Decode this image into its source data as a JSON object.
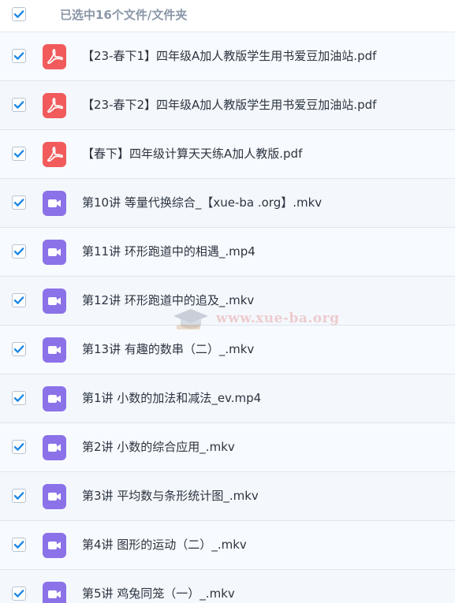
{
  "header": {
    "title": "已选中16个文件/文件夹",
    "select_all_checked": true
  },
  "files": [
    {
      "name": "【23-春下1】四年级A加人教版学生用书爱豆加油站.pdf",
      "type": "pdf",
      "icon": "pdf-icon",
      "checked": true
    },
    {
      "name": "【23-春下2】四年级A加人教版学生用书爱豆加油站.pdf",
      "type": "pdf",
      "icon": "pdf-icon",
      "checked": true
    },
    {
      "name": "【春下】四年级计算天天练A加人教版.pdf",
      "type": "pdf",
      "icon": "pdf-icon",
      "checked": true
    },
    {
      "name": "第10讲 等量代换综合_【xue-ba .org】.mkv",
      "type": "video",
      "icon": "video-icon",
      "checked": true
    },
    {
      "name": "第11讲 环形跑道中的相遇_.mp4",
      "type": "video",
      "icon": "video-icon",
      "checked": true
    },
    {
      "name": "第12讲 环形跑道中的追及_.mkv",
      "type": "video",
      "icon": "video-icon",
      "checked": true
    },
    {
      "name": "第13讲 有趣的数串（二）_.mkv",
      "type": "video",
      "icon": "video-icon",
      "checked": true
    },
    {
      "name": "第1讲 小数的加法和减法_ev.mp4",
      "type": "video",
      "icon": "video-icon",
      "checked": true
    },
    {
      "name": "第2讲 小数的综合应用_.mkv",
      "type": "video",
      "icon": "video-icon",
      "checked": true
    },
    {
      "name": "第3讲 平均数与条形统计图_.mkv",
      "type": "video",
      "icon": "video-icon",
      "checked": true
    },
    {
      "name": "第4讲 图形的运动（二）_.mkv",
      "type": "video",
      "icon": "video-icon",
      "checked": true
    },
    {
      "name": "第5讲 鸡兔同笼（一）_.mkv",
      "type": "video",
      "icon": "video-icon",
      "checked": true
    }
  ],
  "watermark": {
    "text": "www.xue-ba.org",
    "icon": "graduation-cap-icon"
  },
  "colors": {
    "checkbox_tick": "#1e88e5",
    "pdf_icon_bg": "#f15b5b",
    "video_icon_bg": "#8b72e8",
    "header_text": "#8a97a8",
    "row_bg": "#f7fafe"
  }
}
